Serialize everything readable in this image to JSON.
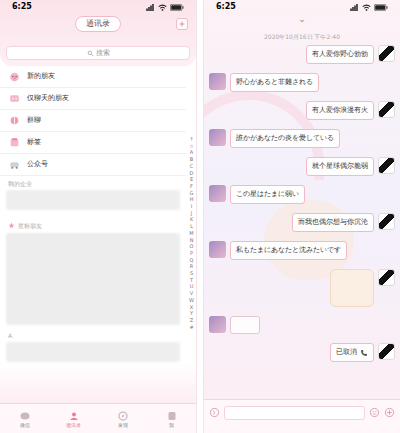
{
  "contacts": {
    "status_bar": {
      "time": "6:25"
    },
    "title": "通讯录",
    "search": {
      "placeholder": "搜索"
    },
    "menu": [
      {
        "label": "新的朋友"
      },
      {
        "label": "仅聊天的朋友"
      },
      {
        "label": "群聊"
      },
      {
        "label": "标签"
      },
      {
        "label": "公众号"
      }
    ],
    "enterprise_header": "我的企业",
    "starred_header": "星标朋友",
    "letter_header": "A",
    "index": [
      "↑",
      "☆",
      "A",
      "B",
      "C",
      "D",
      "E",
      "F",
      "G",
      "H",
      "I",
      "J",
      "K",
      "L",
      "M",
      "N",
      "O",
      "P",
      "Q",
      "R",
      "S",
      "T",
      "U",
      "V",
      "W",
      "X",
      "Y",
      "Z",
      "#"
    ],
    "tabs": [
      {
        "label": "微信",
        "selected": false
      },
      {
        "label": "通讯录",
        "selected": true
      },
      {
        "label": "发现",
        "selected": false
      },
      {
        "label": "我",
        "selected": false
      }
    ]
  },
  "chat": {
    "status_bar": {
      "time": "6:25"
    },
    "collapse_icon": "⌄",
    "timestamp": "2020年10月16日 下午2:40",
    "messages": [
      {
        "kind": "text",
        "side": "right",
        "text": "有人爱你野心勃勃"
      },
      {
        "kind": "text",
        "side": "left",
        "text": "野心があると非難される"
      },
      {
        "kind": "text",
        "side": "right",
        "text": "有人爱你浪漫有火"
      },
      {
        "kind": "text",
        "side": "left",
        "text": "誰かがあなたの炎を愛している"
      },
      {
        "kind": "text",
        "side": "right",
        "text": "就个星球偶尔脆弱"
      },
      {
        "kind": "text",
        "side": "left",
        "text": "この星はたまに弱い"
      },
      {
        "kind": "text",
        "side": "right",
        "text": "而我也偶尔想与你沉沦"
      },
      {
        "kind": "text",
        "side": "left",
        "text": "私もたまにあなたと沈みたいです"
      },
      {
        "kind": "sticker",
        "side": "right"
      },
      {
        "kind": "sticker",
        "side": "left"
      },
      {
        "kind": "call",
        "side": "right",
        "text": "已取消"
      }
    ]
  }
}
